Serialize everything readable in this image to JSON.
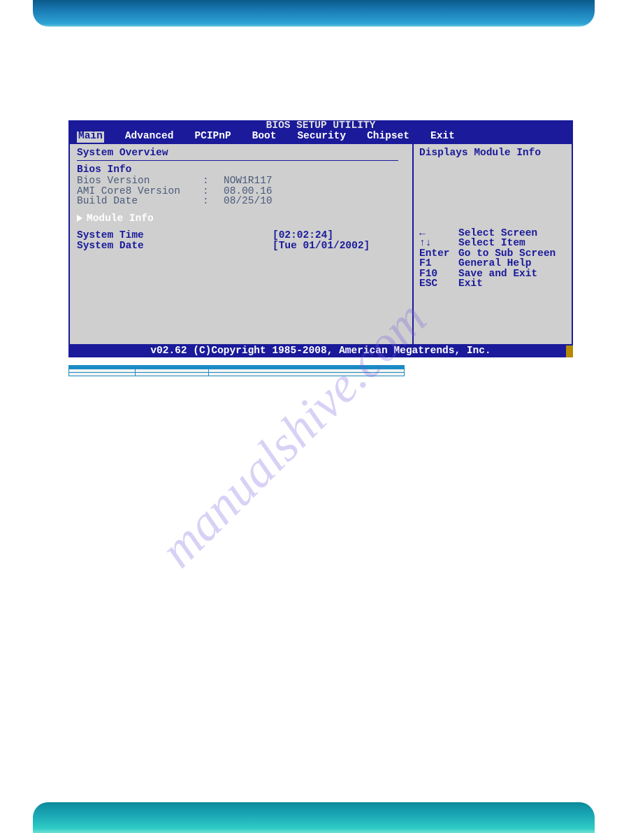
{
  "watermark": "manualshive.com",
  "bios": {
    "title": "BIOS SETUP UTILITY",
    "tabs": {
      "main": "Main",
      "advanced": "Advanced",
      "pcipnp": "PCIPnP",
      "boot": "Boot",
      "security": "Security",
      "chipset": "Chipset",
      "exit": "Exit"
    },
    "left": {
      "system_overview": "System Overview",
      "bios_info": "Bios Info",
      "bios_version_label": "Bios Version",
      "bios_version_value": "NOW1R117",
      "ami_core_label": "AMI Core8 Version",
      "ami_core_value": "08.00.16",
      "build_date_label": "Build Date",
      "build_date_value": "08/25/10",
      "module_info": "Module Info",
      "system_time_label": "System Time",
      "system_time_value": "[02:02:24]",
      "system_date_label": "System Date",
      "system_date_value": "[Tue 01/01/2002]"
    },
    "right": {
      "help_title": "Displays Module Info",
      "keys": {
        "k0": "←",
        "v0": "Select Screen",
        "k1": "↑↓",
        "v1": "Select Item",
        "k2": "Enter",
        "v2": "Go to Sub Screen",
        "k3": "F1",
        "v3": "General Help",
        "k4": "F10",
        "v4": "Save and Exit",
        "k5": "ESC",
        "v5": "Exit"
      }
    },
    "footer": "v02.62 (C)Copyright 1985-2008, American Megatrends, Inc."
  },
  "table": {
    "headers": {
      "h1": "",
      "h2": "",
      "h3": ""
    },
    "rows": [
      {
        "c1": "",
        "c2": "",
        "c3": ""
      },
      {
        "c1": "",
        "c2": "",
        "c3": ""
      }
    ]
  }
}
